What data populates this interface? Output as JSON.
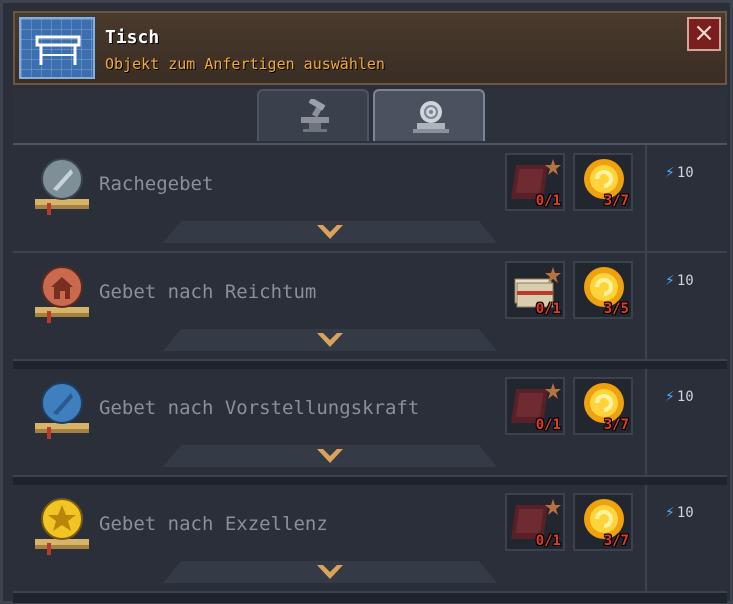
{
  "header": {
    "title": "Tisch",
    "subtitle": "Objekt zum Anfertigen auswählen",
    "icon": "table-icon",
    "close_label": "×"
  },
  "tabs": [
    {
      "icon": "anvil-hammer-icon",
      "active": false
    },
    {
      "icon": "prayer-altar-icon",
      "active": true
    }
  ],
  "recipes": [
    {
      "name": "Rachegebet",
      "icon": "feather-orb-gray-icon",
      "ingredients": [
        {
          "icon": "book-icon",
          "count": "0/1"
        },
        {
          "icon": "gold-orb-icon",
          "count": "3/7"
        }
      ],
      "energy": "10"
    },
    {
      "name": "Gebet nach Reichtum",
      "icon": "house-orb-red-icon",
      "ingredients": [
        {
          "icon": "papers-icon",
          "count": "0/1"
        },
        {
          "icon": "gold-orb-icon",
          "count": "3/5"
        }
      ],
      "energy": "10"
    },
    {
      "name": "Gebet nach Vorstellungskraft",
      "icon": "feather-orb-blue-icon",
      "ingredients": [
        {
          "icon": "book-icon",
          "count": "0/1"
        },
        {
          "icon": "gold-orb-icon",
          "count": "3/7"
        }
      ],
      "energy": "10"
    },
    {
      "name": "Gebet nach Exzellenz",
      "icon": "star-orb-gold-icon",
      "ingredients": [
        {
          "icon": "book-icon",
          "count": "0/1"
        },
        {
          "icon": "gold-orb-icon",
          "count": "3/7"
        }
      ],
      "energy": "10"
    }
  ],
  "colors": {
    "title": "#ffffff",
    "subtitle": "#f1a93c",
    "count": "#e03a2c",
    "energy_bolt": "#4aa8ff"
  }
}
